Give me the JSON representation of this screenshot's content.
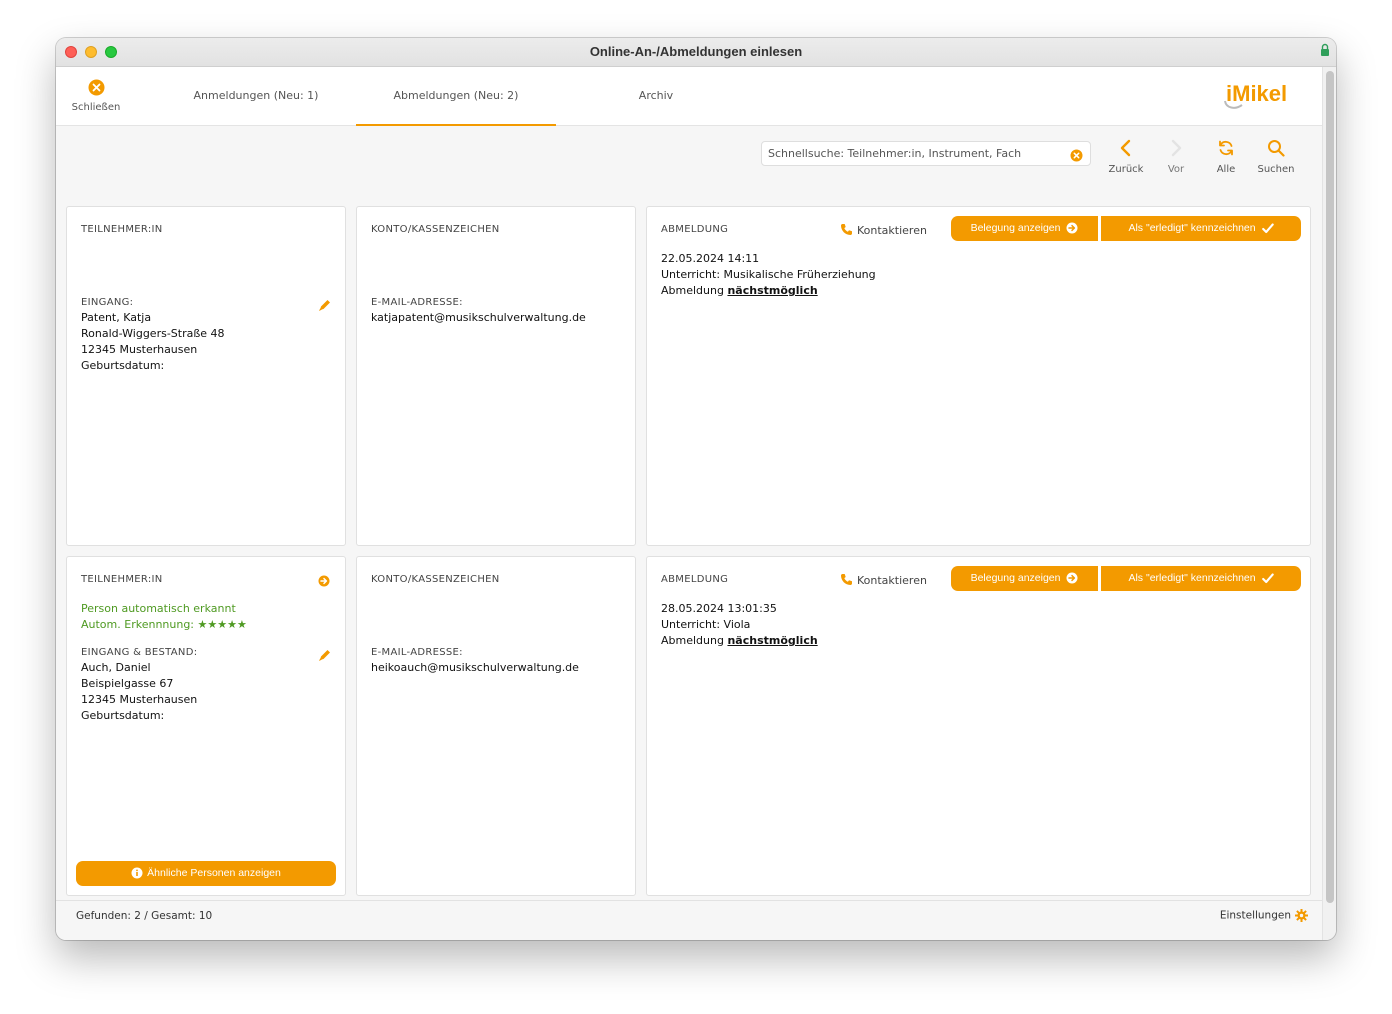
{
  "window": {
    "title": "Online-An-/Abmeldungen einlesen"
  },
  "colors": {
    "accent": "#f39a00",
    "green": "#4f9a22"
  },
  "toolbar": {
    "close_label": "Schließen",
    "tabs": [
      {
        "label": "Anmeldungen (Neu: 1)"
      },
      {
        "label": "Abmeldungen (Neu: 2)",
        "active": true
      },
      {
        "label": "Archiv"
      }
    ],
    "logo_text": "iMikel"
  },
  "search": {
    "placeholder": "Schnellsuche: Teilnehmer:in, Instrument, Fach",
    "value": ""
  },
  "nav": {
    "back": "Zurück",
    "forward": "Vor",
    "all": "Alle",
    "search": "Suchen"
  },
  "records": [
    {
      "participant": {
        "header": "TEILNEHMER:IN",
        "section_label": "EINGANG:",
        "name": "Patent, Katja",
        "street": "Ronald-Wiggers-Straße 48",
        "city": "12345 Musterhausen",
        "birth_label": "Geburtsdatum:"
      },
      "account": {
        "header": "KONTO/KASSENZEICHEN",
        "email_label": "E-MAIL-ADRESSE:",
        "email": "katjapatent@musikschulverwaltung.de"
      },
      "cancellation": {
        "header": "ABMELDUNG",
        "contact": "Kontaktieren",
        "show_booking": "Belegung anzeigen",
        "mark_done": "Als \"erledigt\" kennzeichnen",
        "datetime": "22.05.2024 14:11",
        "lesson": "Unterricht: Musikalische Früherziehung",
        "type_prefix": "Abmeldung",
        "type_value": "nächstmöglich"
      }
    },
    {
      "participant": {
        "header": "TEILNEHMER:IN",
        "auto_recognized": "Person automatisch erkannt",
        "recognition_label": "Autom. Erkennnung:",
        "recognition_stars": "★★★★★",
        "section_label": "EINGANG & BESTAND:",
        "name": "Auch, Daniel",
        "street": "Beispielgasse 67",
        "city": "12345 Musterhausen",
        "birth_label": "Geburtsdatum:",
        "similar_button": "Ähnliche Personen anzeigen"
      },
      "account": {
        "header": "KONTO/KASSENZEICHEN",
        "email_label": "E-MAIL-ADRESSE:",
        "email": "heikoauch@musikschulverwaltung.de"
      },
      "cancellation": {
        "header": "ABMELDUNG",
        "contact": "Kontaktieren",
        "show_booking": "Belegung anzeigen",
        "mark_done": "Als \"erledigt\" kennzeichnen",
        "datetime": "28.05.2024 13:01:35",
        "lesson": "Unterricht: Viola",
        "type_prefix": "Abmeldung",
        "type_value": "nächstmöglich"
      }
    }
  ],
  "footer": {
    "stats": "Gefunden: 2 / Gesamt: 10",
    "settings": "Einstellungen"
  }
}
